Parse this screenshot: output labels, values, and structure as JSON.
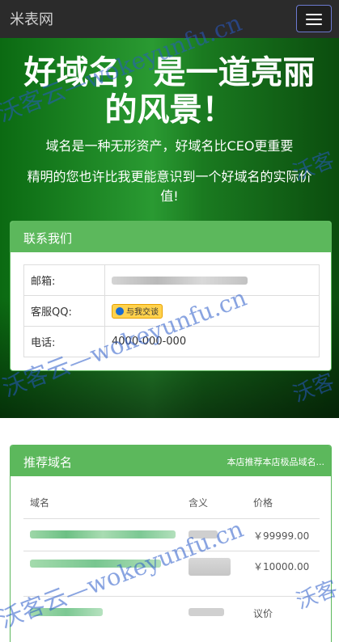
{
  "navbar": {
    "brand": "米表网",
    "menu_icon": "hamburger-icon"
  },
  "hero": {
    "title_line1": "好域名，是一道亮丽",
    "title_line2": "的风景！",
    "subtitle": "域名是一种无形资产，好域名比CEO更重要",
    "desc_line1": "精明的您也许比我更能意识到一个好域名的实际价",
    "desc_line2": "值!"
  },
  "contact": {
    "title": "联系我们",
    "email_label": "邮箱:",
    "qq_label": "客服QQ:",
    "qq_button": "与我交谈",
    "phone_label": "电话:",
    "phone_value": "4000-000-000"
  },
  "domains": {
    "title": "推荐域名",
    "extra": "本店推荐本店极品域名...",
    "headers": [
      "域名",
      "含义",
      "价格"
    ],
    "rows": [
      {
        "price": "￥99999.00"
      },
      {
        "price": "￥10000.00"
      },
      {
        "price": "议价"
      }
    ]
  },
  "watermark": {
    "text": "沃客云—wokeyunfu.cn",
    "short": "沃客"
  },
  "colors": {
    "panel_green": "#5cb85c",
    "navbar": "#2b2b2b",
    "watermark": "#2d5ac8"
  }
}
